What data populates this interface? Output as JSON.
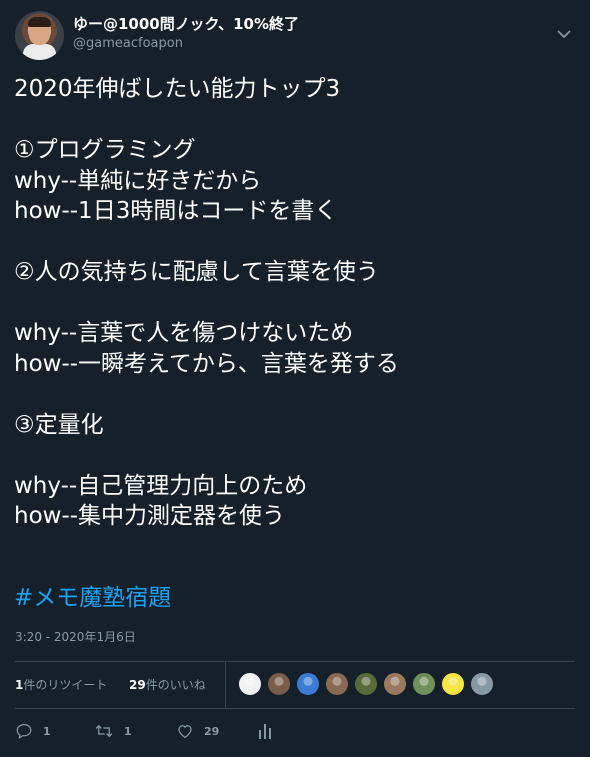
{
  "tweet": {
    "author": {
      "display_name": "ゆー@1000問ノック、10%終了",
      "handle": "@gameacfoapon"
    },
    "body": "2020年伸ばしたい能力トップ3\n\n①プログラミング\nwhy--単純に好きだから\nhow--1日3時間はコードを書く\n\n②人の気持ちに配慮して言葉を使う\n\nwhy--言葉で人を傷つけないため\nhow--一瞬考えてから、言葉を発する\n\n③定量化\n\nwhy--自己管理力向上のため\nhow--集中力測定器を使う",
    "hashtag": "#メモ魔塾宿題",
    "timestamp": "3:20 - 2020年1月6日"
  },
  "stats": {
    "retweets": {
      "count": "1",
      "label": "件のリツイート"
    },
    "likes": {
      "count": "29",
      "label": "件のいいね"
    }
  },
  "liker_colors": [
    "#f2f2f2",
    "#7a5c4a",
    "#3b7bd4",
    "#8a6a52",
    "#5a6b3a",
    "#9a7a5e",
    "#6f8f5a",
    "#f5e642",
    "#8899a6"
  ],
  "actions": {
    "reply_count": "1",
    "retweet_count": "1",
    "like_count": "29"
  },
  "icons": {
    "caret": "chevron-down-icon",
    "reply": "reply-icon",
    "retweet": "retweet-icon",
    "like": "heart-icon",
    "analytics": "analytics-icon"
  },
  "colors": {
    "background": "#15202b",
    "text": "#ffffff",
    "muted": "#8899a6",
    "link": "#1da1f2",
    "divider": "#38444d"
  }
}
